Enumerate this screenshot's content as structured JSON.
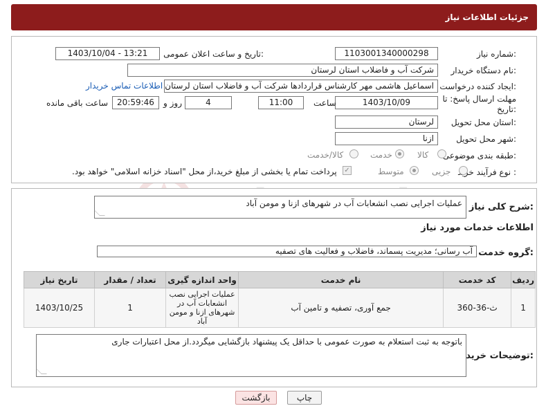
{
  "header": {
    "title": "جزئیات اطلاعات نیاز"
  },
  "form": {
    "need_number": {
      "label": "شماره نیاز:",
      "value": "1103001340000298"
    },
    "announce_datetime": {
      "label": "تاریخ و ساعت اعلان عمومی:",
      "value": "1403/10/04 - 13:21"
    },
    "buyer_org": {
      "label": "نام دستگاه خریدار:",
      "value": "شرکت آب و فاضلاب استان لرستان"
    },
    "requester": {
      "label": "ایجاد کننده درخواست:",
      "value": "اسماعیل هاشمی مهر کارشناس قراردادها شرکت آب و فاضلاب استان لرستان",
      "contact_link": "اطلاعات تماس خریدار"
    },
    "deadline": {
      "label": "مهلت ارسال پاسخ: تا تاریخ:",
      "date": "1403/10/09",
      "time_label": "ساعت",
      "time": "11:00",
      "days": "4",
      "days_label": "روز و",
      "remaining": "20:59:46",
      "remaining_label": "ساعت باقی مانده"
    },
    "province": {
      "label": "استان محل تحویل:",
      "value": "لرستان"
    },
    "city": {
      "label": "شهر محل تحویل:",
      "value": "ازنا"
    },
    "category": {
      "label": "طبقه بندی موضوعی:",
      "options": [
        "کالا",
        "خدمت",
        "کالا/خدمت"
      ],
      "selected": "خدمت"
    },
    "purchase_type": {
      "label": "نوع فرآیند خرید :",
      "options": [
        "جزیی",
        "متوسط"
      ],
      "selected": "متوسط",
      "payment_note": "پرداخت تمام یا بخشی از مبلغ خرید،از محل \"اسناد خزانه اسلامی\" خواهد بود."
    }
  },
  "summary": {
    "label": "شرح کلی نیاز:",
    "value": "عملیات اجرایی نصب انشعابات آب در شهرهای ازنا و مومن آباد"
  },
  "services_section": {
    "title": "اطلاعات خدمات مورد نیاز",
    "group_label": "گروه خدمت:",
    "group_value": "آب رسانی؛ مدیریت پسماند، فاضلاب و فعالیت های تصفیه"
  },
  "table": {
    "headers": [
      "ردیف",
      "کد خدمت",
      "نام خدمت",
      "واحد اندازه گیری",
      "تعداد / مقدار",
      "تاریخ نیاز"
    ],
    "rows": [
      {
        "row": "1",
        "code": "ث-36-360",
        "name": "جمع آوری، تصفیه و تامین آب",
        "unit": "عملیات اجرایی نصب انشعابات آب در شهرهای ازنا و مومن آباد",
        "qty": "1",
        "date": "1403/10/25"
      }
    ]
  },
  "buyer_notes": {
    "label": "توضیحات خریدار:",
    "value": "باتوجه به ثبت استعلام به صورت عمومی با حداقل یک پیشنهاد بازگشایی میگردد.از محل اعتبارات جاری"
  },
  "buttons": {
    "print": "چاپ",
    "back": "بازگشت"
  },
  "watermark": {
    "text": "AriaTender.neT"
  }
}
